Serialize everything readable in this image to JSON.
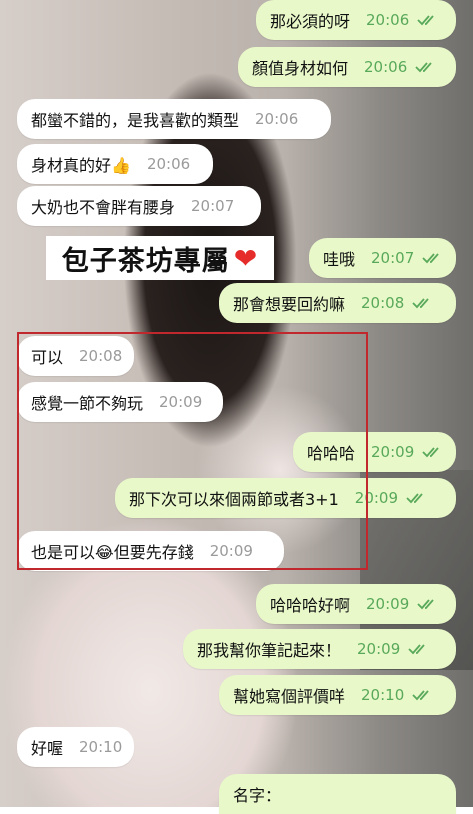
{
  "chat": {
    "messages": [
      {
        "direction": "out",
        "text": "那必須的呀",
        "time": "20:06",
        "read": true
      },
      {
        "direction": "out",
        "text": "顏值身材如何",
        "time": "20:06",
        "read": true
      },
      {
        "direction": "in",
        "text": "都蠻不錯的，是我喜歡的類型",
        "time": "20:06"
      },
      {
        "direction": "in",
        "text": "身材真的好👍",
        "time": "20:06"
      },
      {
        "direction": "in",
        "text": "大奶也不會胖有腰身",
        "time": "20:07"
      },
      {
        "direction": "out",
        "text": "哇哦",
        "time": "20:07",
        "read": true
      },
      {
        "direction": "out",
        "text": "那會想要回約嘛",
        "time": "20:08",
        "read": true
      },
      {
        "direction": "in",
        "text": "可以",
        "time": "20:08"
      },
      {
        "direction": "in",
        "text": "感覺一節不夠玩",
        "time": "20:09"
      },
      {
        "direction": "out",
        "text": "哈哈哈",
        "time": "20:09",
        "read": true
      },
      {
        "direction": "out",
        "text": "那下次可以來個兩節或者3+1",
        "time": "20:09",
        "read": true
      },
      {
        "direction": "in",
        "text": "也是可以😂但要先存錢",
        "time": "20:09"
      },
      {
        "direction": "out",
        "text": "哈哈哈好啊",
        "time": "20:09",
        "read": true
      },
      {
        "direction": "out",
        "text": "那我幫你筆記起來！",
        "time": "20:09",
        "read": true
      },
      {
        "direction": "out",
        "text": "幫她寫個評價咩",
        "time": "20:10",
        "read": true
      },
      {
        "direction": "in",
        "text": "好喔",
        "time": "20:10"
      },
      {
        "direction": "out",
        "text": "名字：",
        "time": "",
        "read": false
      }
    ]
  },
  "watermark": {
    "text": "包子茶坊專屬",
    "icon": "heart-icon"
  },
  "colors": {
    "incoming_bubble": "#ffffff",
    "outgoing_bubble": "#e8f8c9",
    "outgoing_time": "#59a95a",
    "read_ticks": "#59a95a",
    "highlight_border": "#c0282d"
  }
}
